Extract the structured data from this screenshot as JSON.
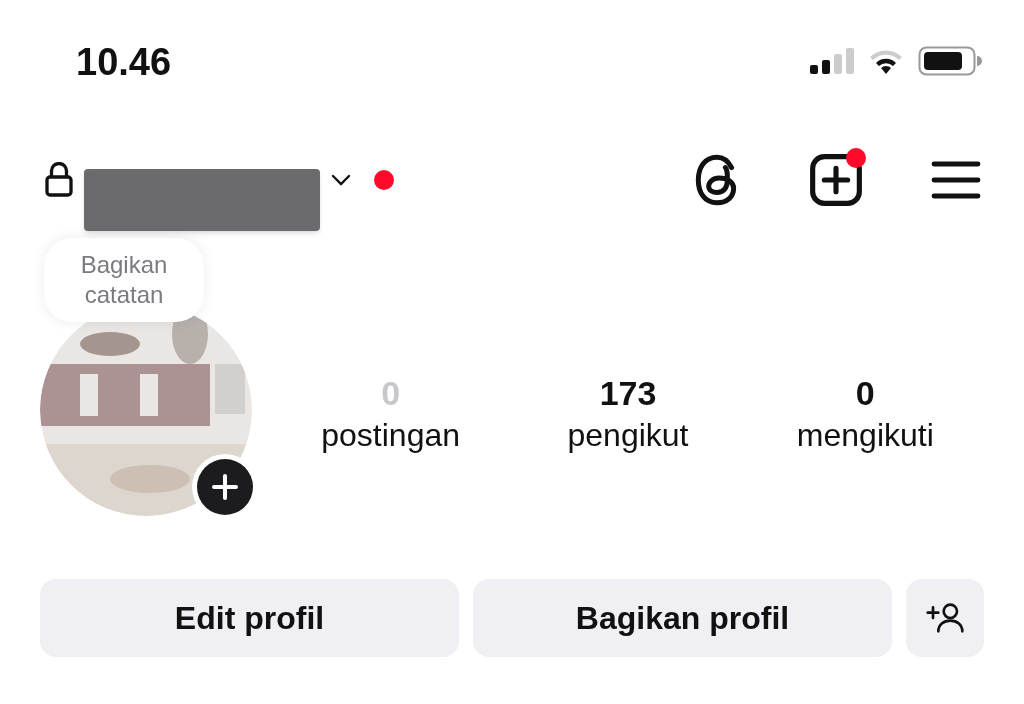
{
  "status_bar": {
    "time": "10.46"
  },
  "header": {
    "locked": true,
    "unread_dot": true,
    "redacted": true,
    "actions": [
      {
        "kind": "threads",
        "badge": false
      },
      {
        "kind": "create",
        "badge": true
      },
      {
        "kind": "menu",
        "badge": false
      }
    ]
  },
  "profile": {
    "note_bubble": "Bagikan catatan",
    "add_story": true
  },
  "stats": [
    {
      "value": "0",
      "label": "postingan",
      "dimmed": true
    },
    {
      "value": "173",
      "label": "pengikut",
      "dimmed": false
    },
    {
      "value": "0",
      "label": "mengikuti",
      "dimmed": false
    }
  ],
  "buttons": [
    {
      "kind": "text",
      "label": "Edit profil"
    },
    {
      "kind": "text",
      "label": "Bagikan profil"
    },
    {
      "kind": "add-person"
    }
  ]
}
